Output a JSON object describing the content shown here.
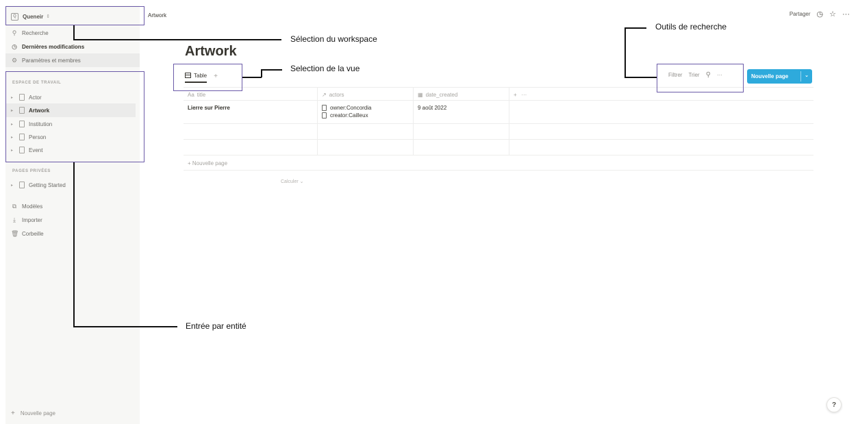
{
  "sidebar": {
    "workspace": "Queneir",
    "nav": [
      {
        "icon": "search-icon",
        "label": "Recherche"
      },
      {
        "icon": "clock-icon",
        "label": "Dernières modifications"
      },
      {
        "icon": "gear-icon",
        "label": "Paramètres et membres"
      }
    ],
    "workspace_section_label": "ESPACE DE TRAVAIL",
    "workspace_pages": [
      "Actor",
      "Artwork",
      "Institution",
      "Person",
      "Event"
    ],
    "private_section_label": "PAGES PRIVÉES",
    "private_pages": [
      "Getting Started"
    ],
    "utilities": [
      {
        "icon": "templates-icon",
        "label": "Modèles"
      },
      {
        "icon": "import-icon",
        "label": "Importer"
      },
      {
        "icon": "trash-icon",
        "label": "Corbeille"
      }
    ],
    "new_page": "Nouvelle page"
  },
  "topbar": {
    "breadcrumb": "Artwork",
    "share": "Partager"
  },
  "main": {
    "title": "Artwork",
    "tab_label": "Table",
    "toolbar": {
      "filter": "Filtrer",
      "sort": "Trier",
      "new_page": "Nouvelle page"
    },
    "table": {
      "headers": [
        "title",
        "actors",
        "date_created"
      ],
      "rows": [
        {
          "title": "Lierre sur Pierre",
          "actors": [
            "owner:Concordia",
            "creator:Cailleux"
          ],
          "date": "9 août 2022"
        }
      ],
      "new_row": "Nouvelle page",
      "calculate": "Calculer"
    }
  },
  "annotations": {
    "workspace": "Sélection du workspace",
    "view": "Selection de la vue",
    "search_tools": "Outils de recherche",
    "entity": "Entrée par entité"
  },
  "help": "?"
}
